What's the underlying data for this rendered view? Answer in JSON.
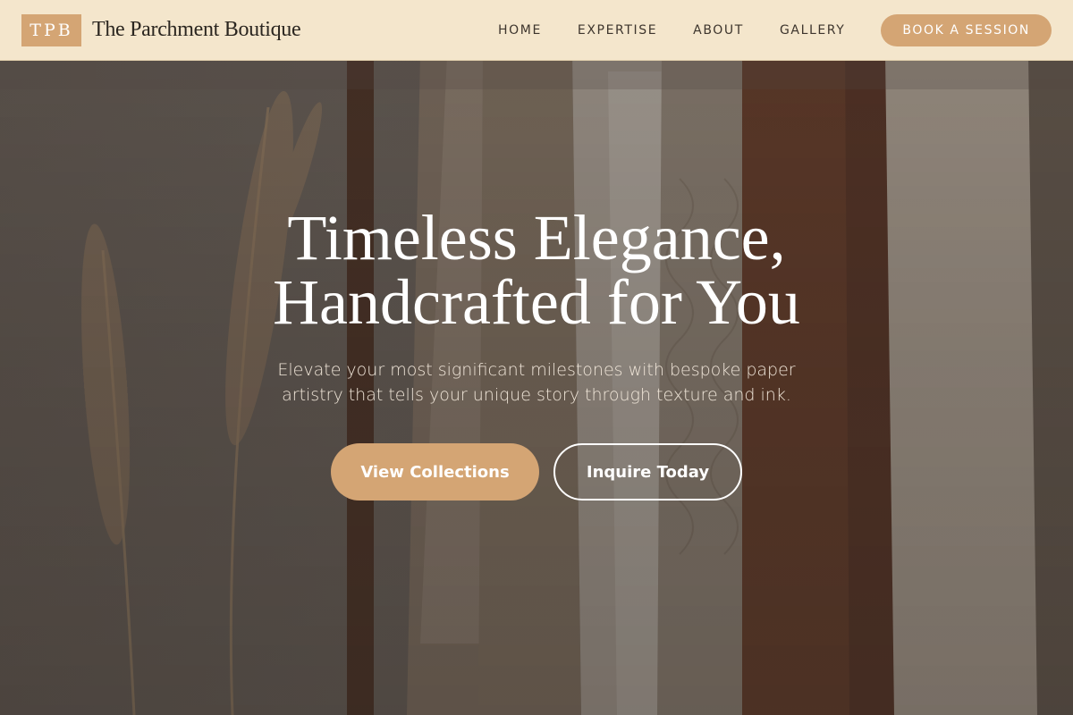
{
  "header": {
    "logo_mark": "TPB",
    "brand_name": "The Parchment Boutique",
    "nav": [
      {
        "label": "HOME"
      },
      {
        "label": "EXPERTISE"
      },
      {
        "label": "ABOUT"
      },
      {
        "label": "GALLERY"
      }
    ],
    "cta_label": "BOOK A SESSION"
  },
  "hero": {
    "title_line_1": "Timeless Elegance,",
    "title_line_2": "Handcrafted for You",
    "subtitle": "Elevate your most significant milestones with bespoke paper artistry that tells your unique story through texture and ink.",
    "primary_button": "View Collections",
    "secondary_button": "Inquire Today",
    "background_image": "clothing-rack-pampas-grass-photo"
  },
  "colors": {
    "accent": "#d4a574",
    "header_bg": "#f4e6cc",
    "brand_text": "#2b2620",
    "hero_text": "#ffffff"
  }
}
